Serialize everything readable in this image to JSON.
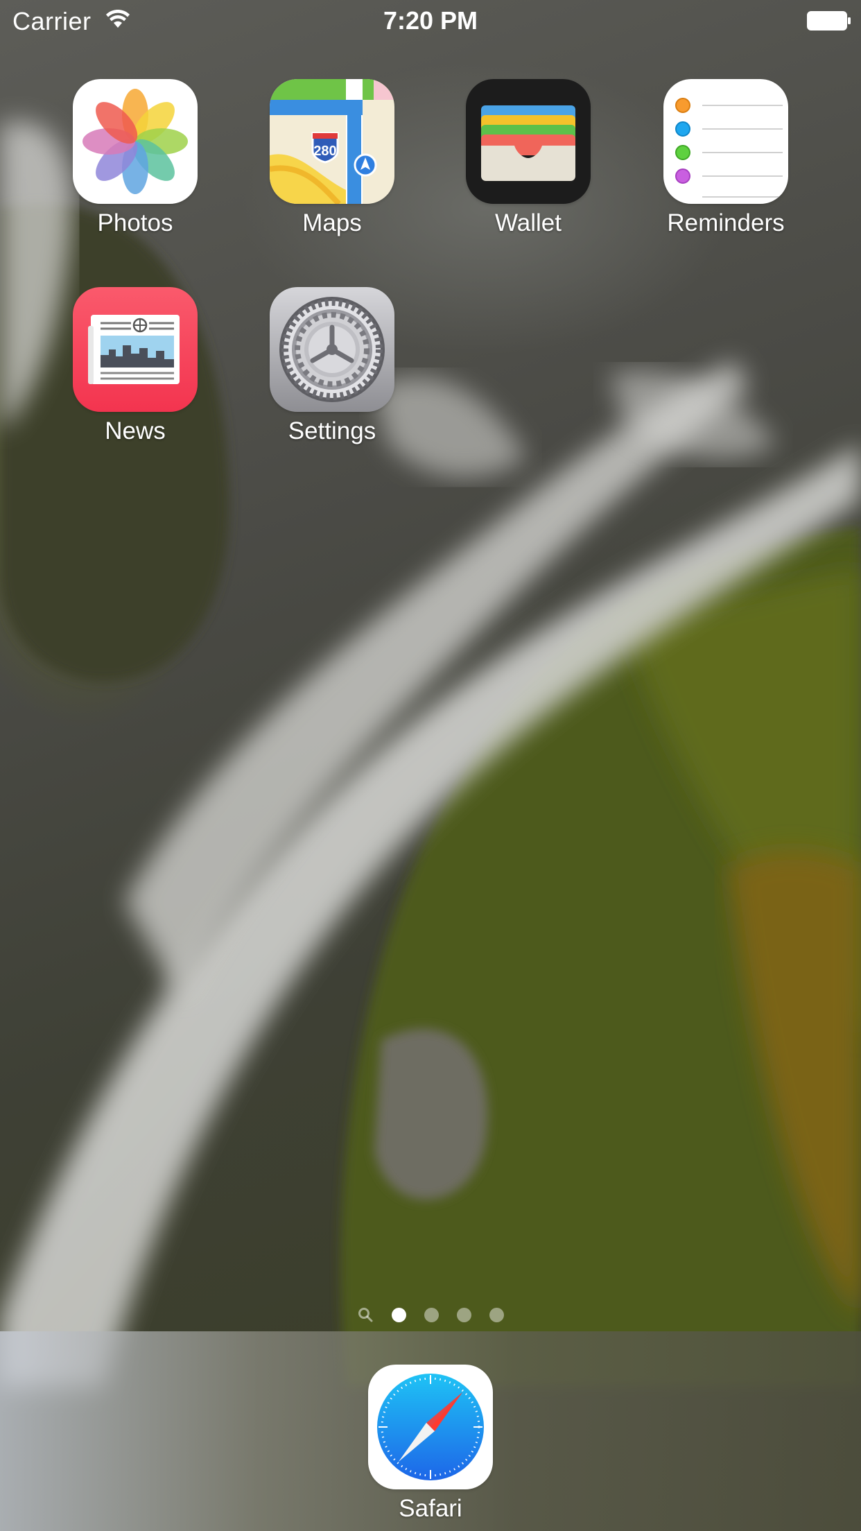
{
  "status_bar": {
    "carrier": "Carrier",
    "time": "7:20 PM",
    "wifi_icon": "wifi-icon",
    "battery_icon": "battery-icon"
  },
  "home_screen": {
    "apps": [
      {
        "label": "Photos",
        "icon": "photos-icon"
      },
      {
        "label": "Maps",
        "icon": "maps-icon",
        "route_shield": "280"
      },
      {
        "label": "Wallet",
        "icon": "wallet-icon"
      },
      {
        "label": "Reminders",
        "icon": "reminders-icon"
      },
      {
        "label": "News",
        "icon": "news-icon"
      },
      {
        "label": "Settings",
        "icon": "settings-icon"
      }
    ]
  },
  "page_indicator": {
    "pages": 4,
    "current_page": 1,
    "has_search_page": true
  },
  "dock": {
    "apps": [
      {
        "label": "Safari",
        "icon": "safari-icon"
      }
    ]
  },
  "colors": {
    "news_red": "#f53d55",
    "wallet_bg": "#1c1c1c",
    "safari_blue": "#1e8cf0",
    "settings_gray": "#8e8e93"
  }
}
